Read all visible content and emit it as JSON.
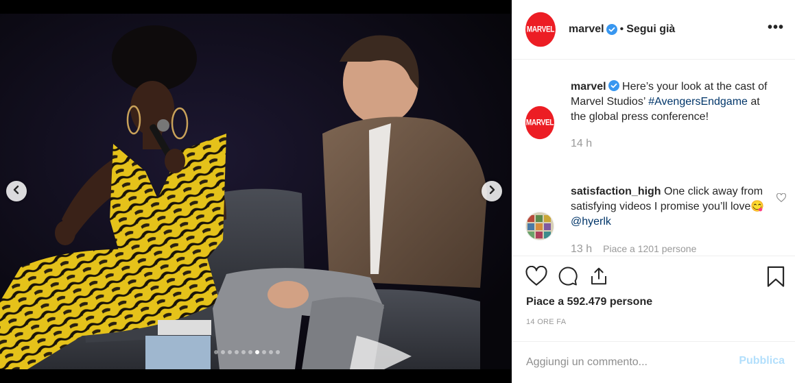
{
  "header": {
    "logo_text": "MARVEL",
    "username": "marvel",
    "separator": "•",
    "follow_label": "Segui già",
    "more_label": "•••"
  },
  "caption": {
    "logo_text": "MARVEL",
    "username": "marvel",
    "text_before": " Here’s your look at the cast of Marvel Studios’ ",
    "hashtag": "#AvengersEndgame",
    "text_after": " at the global press conference!",
    "time": "14 h"
  },
  "comments": [
    {
      "username": "satisfaction_high",
      "text": " One click away from satisfying videos I promise you’ll love",
      "emoji": "😋",
      "mention": "@hyerlk",
      "time": "13 h",
      "likes": "Piace a 1201 persone"
    }
  ],
  "actions": {
    "likes_summary": "Piace a 592.479 persone",
    "posted_ago": "14 ORE FA"
  },
  "composer": {
    "placeholder": "Aggiungi un commento...",
    "publish_label": "Pubblica"
  },
  "carousel": {
    "total_slides": 10,
    "active_slide": 7
  },
  "colors": {
    "brand": "#ec1d24",
    "verified": "#3897f0",
    "link": "#003569",
    "publish_disabled": "#b2dffc"
  }
}
